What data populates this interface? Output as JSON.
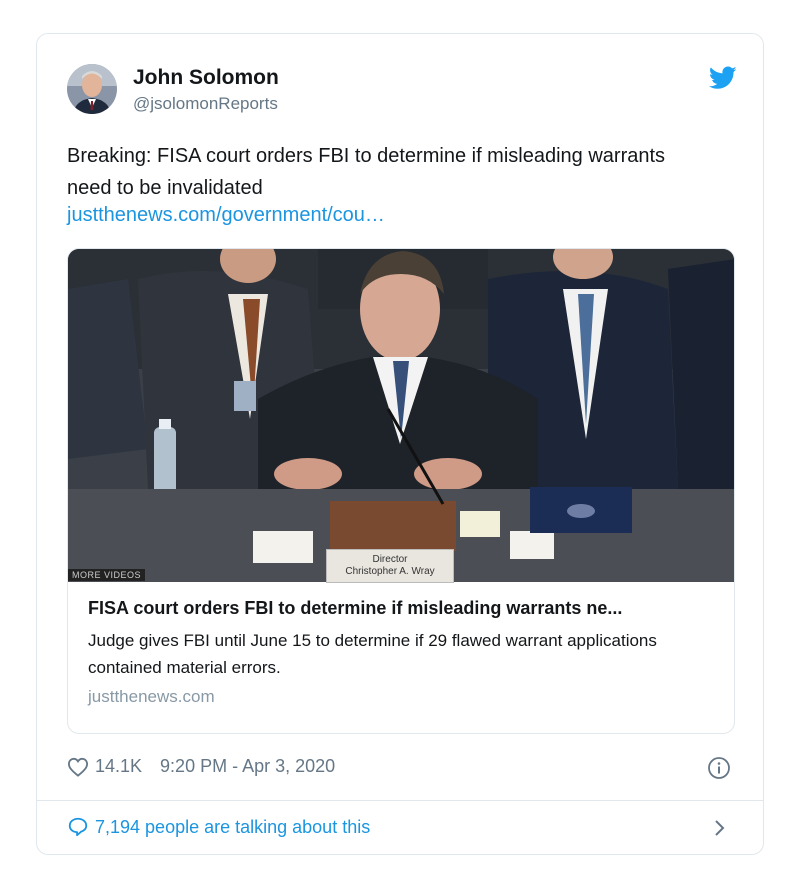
{
  "author": {
    "name": "John Solomon",
    "handle": "@jsolomonReports",
    "avatar_icon": "avatar-photo"
  },
  "tweet": {
    "text": "Breaking: FISA court orders FBI to determine if misleading warrants need to be invalidated",
    "link": "justthenews.com/government/cou…"
  },
  "link_card": {
    "overlay_label": "MORE VIDEOS",
    "placard_line1": "Director",
    "placard_line2": "Christopher A. Wray",
    "title": "FISA court orders FBI to determine if misleading warrants ne...",
    "description": "Judge gives FBI until June 15 to determine if 29 flawed warrant applications contained material errors.",
    "domain": "justthenews.com"
  },
  "meta": {
    "likes": "14.1K",
    "timestamp": "9:20 PM - Apr 3, 2020"
  },
  "conversation": {
    "label": "7,194 people are talking about this"
  },
  "colors": {
    "twitter_blue": "#1da1f2",
    "link_blue": "#1b95e0",
    "muted": "#657786",
    "border": "#e1e8ed"
  }
}
